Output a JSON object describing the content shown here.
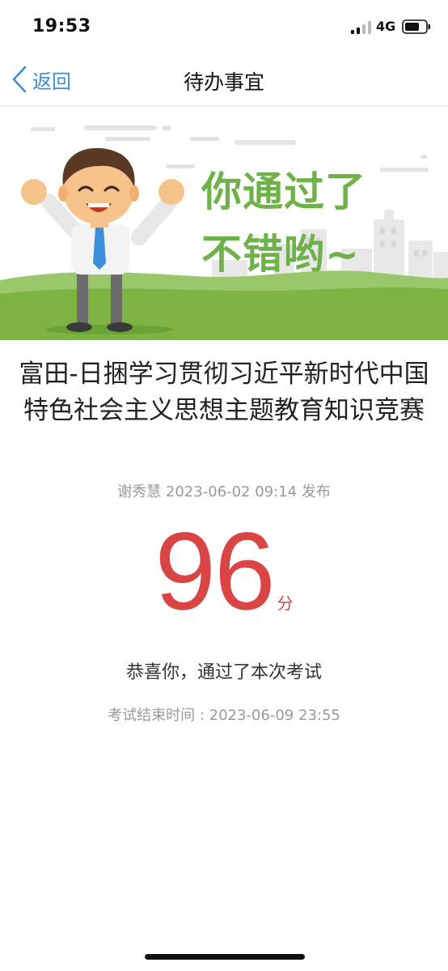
{
  "status_bar": {
    "time": "19:53",
    "network": "4G",
    "icons": [
      "signal-icon",
      "battery-icon"
    ]
  },
  "nav": {
    "back_label": "返回",
    "title": "待办事宜",
    "icons": [
      "chevron-left-icon"
    ]
  },
  "banner": {
    "line1": "你通过了",
    "line2": "不错哟~"
  },
  "exam": {
    "title": "富田-日捆学习贯彻习近平新时代中国特色社会主义思想主题教育知识竞赛",
    "publisher": "谢秀慧",
    "published_at": "2023-06-02 09:14",
    "publish_suffix": "发布",
    "score": "96",
    "score_unit": "分",
    "pass_message": "恭喜你，通过了本次考试",
    "end_time_label": "考试结束时间 : ",
    "end_time": "2023-06-09 23:55"
  },
  "colors": {
    "accent_blue": "#3b8fd9",
    "score_red": "#d94545",
    "banner_green": "#6fb24a"
  }
}
